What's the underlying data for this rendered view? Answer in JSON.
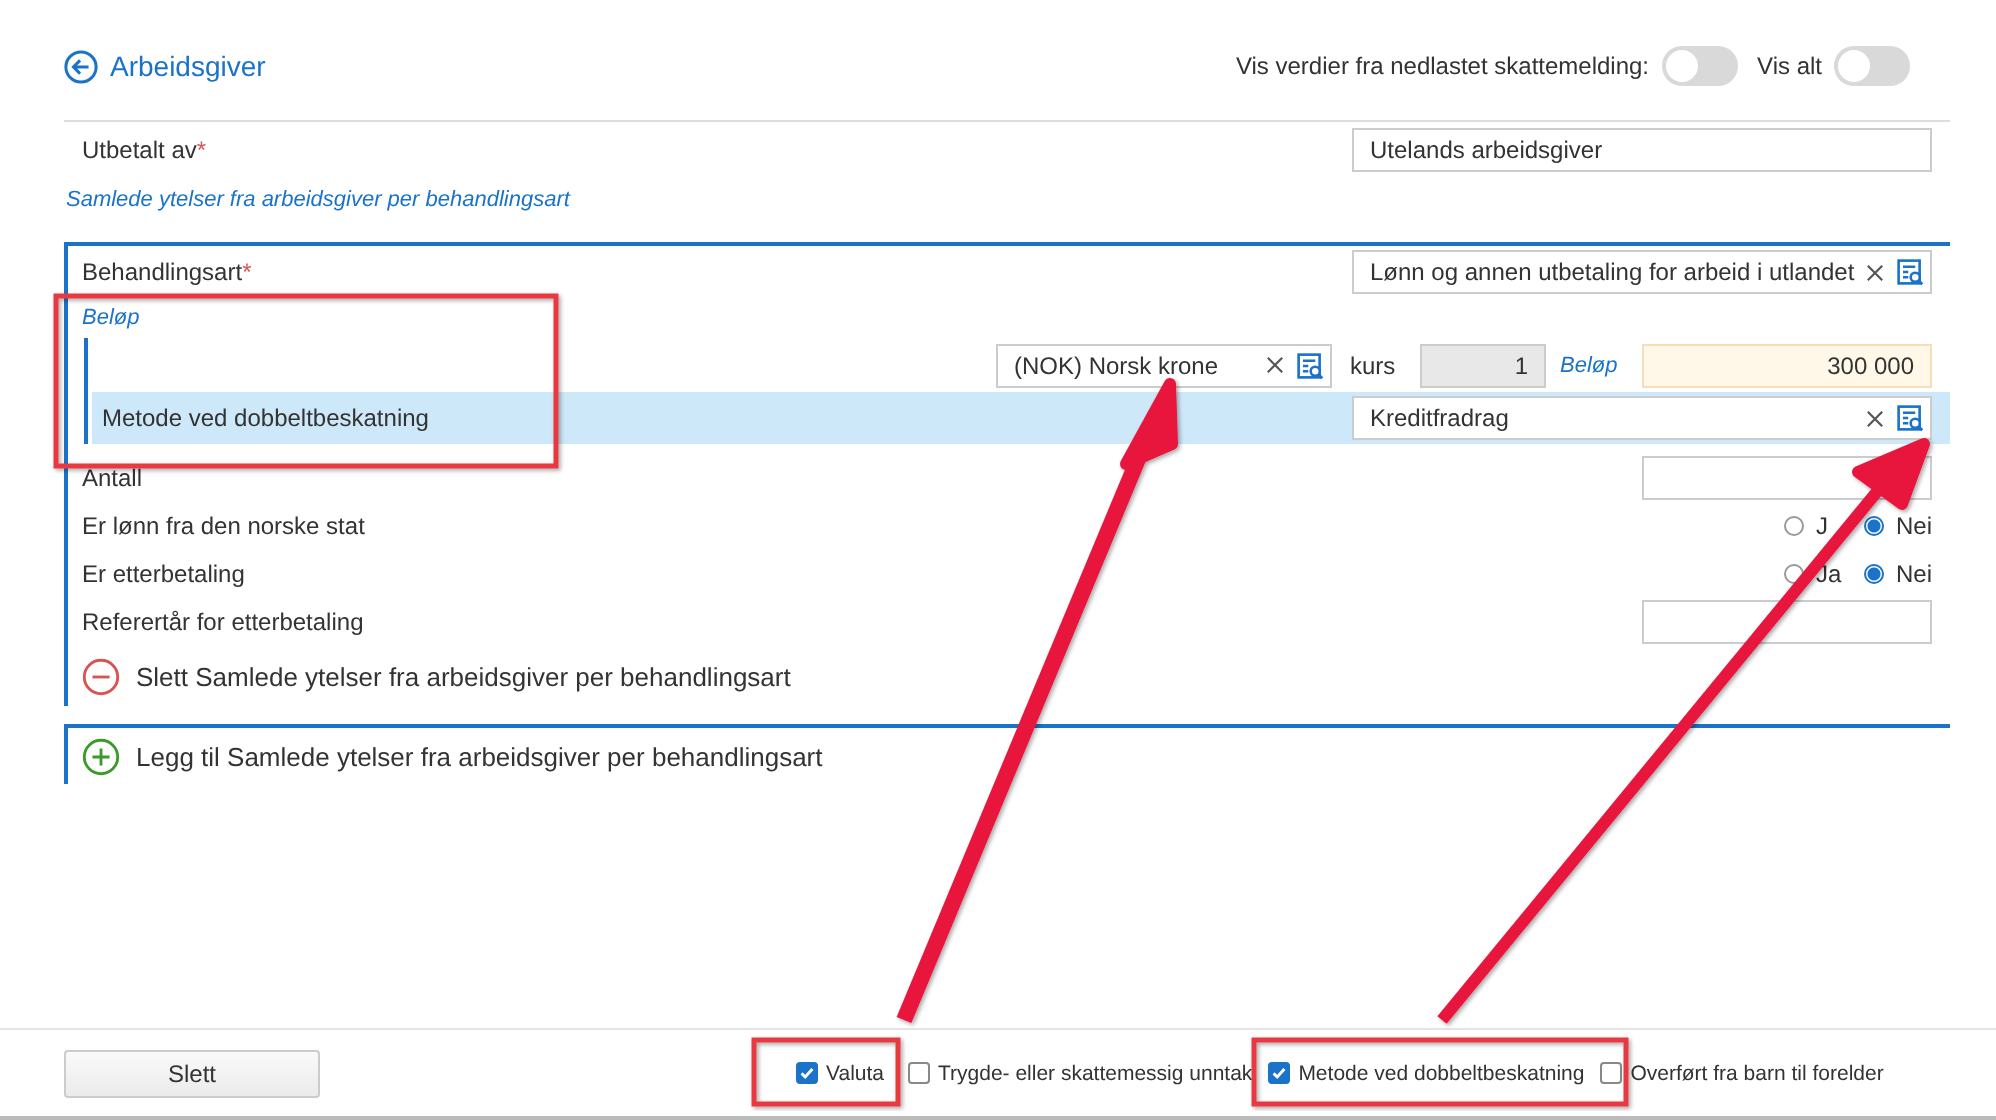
{
  "header": {
    "title": "Arbeidsgiver",
    "toggles": [
      {
        "label": "Vis verdier fra nedlastet skattemelding:",
        "on": false
      },
      {
        "label": "Vis alt",
        "on": false
      }
    ]
  },
  "paid_by": {
    "label": "Utbetalt av",
    "required_mark": "*",
    "value": "Utelands arbeidsgiver"
  },
  "section_link": "Samlede ytelser fra arbeidsgiver per behandlingsart",
  "group": {
    "treatment": {
      "label": "Behandlingsart",
      "required_mark": "*",
      "value": "Lønn og annen utbetaling for arbeid i utlandet"
    },
    "amount_heading": "Beløp",
    "currency": "(NOK) Norsk krone",
    "rate_label": "kurs",
    "rate": "1",
    "amount_label": "Beløp",
    "amount": "300 000",
    "method": {
      "label": "Metode ved dobbeltbeskatning",
      "value": "Kreditfradrag"
    },
    "fields": [
      {
        "kind": "text",
        "label": "Antall"
      },
      {
        "kind": "radio",
        "label": "Er lønn fra den norske stat",
        "options": [
          {
            "label": "J",
            "selected": false
          },
          {
            "label": "Nei",
            "selected": true
          }
        ]
      },
      {
        "kind": "radio",
        "label": "Er etterbetaling",
        "options": [
          {
            "label": "Ja",
            "selected": false
          },
          {
            "label": "Nei",
            "selected": true
          }
        ]
      },
      {
        "kind": "text",
        "label": "Referertår for etterbetaling"
      }
    ],
    "delete_label": "Slett Samlede ytelser fra arbeidsgiver per behandlingsart"
  },
  "add_label": "Legg til Samlede ytelser fra arbeidsgiver per behandlingsart",
  "footer": {
    "button": "Slett",
    "checkboxes": [
      {
        "label": "Valuta",
        "checked": true
      },
      {
        "label": "Trygde- eller skattemessig unntak",
        "checked": false
      },
      {
        "label": "Metode ved dobbeltbeskatning",
        "checked": true
      },
      {
        "label": "Overført fra barn til forelder",
        "checked": false
      }
    ]
  }
}
